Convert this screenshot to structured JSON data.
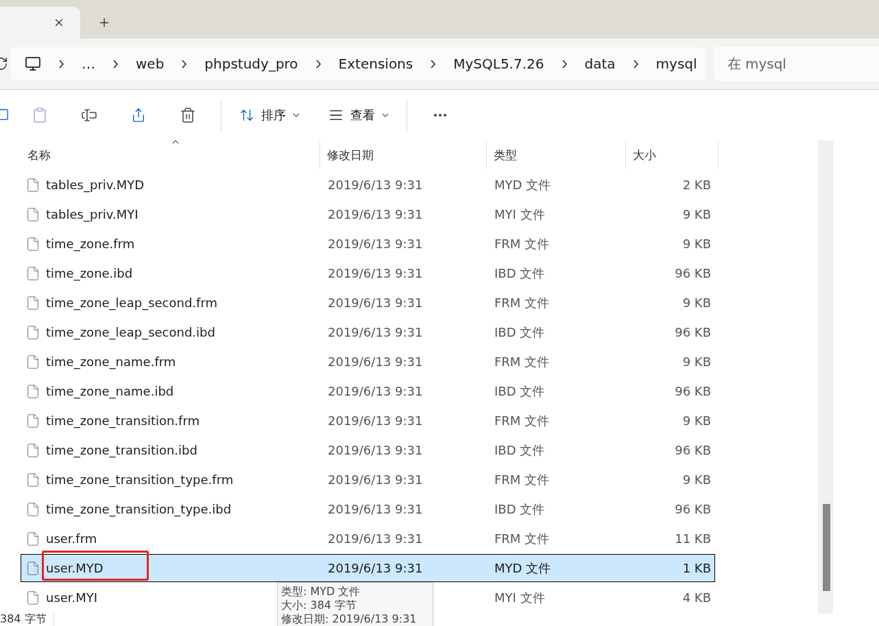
{
  "tabs": [
    {
      "kind": "tab",
      "selected": true
    },
    {
      "kind": "new"
    }
  ],
  "address": {
    "crumbs": [
      "…",
      "web",
      "phpstudy_pro",
      "Extensions",
      "MySQL5.7.26",
      "data",
      "mysql"
    ]
  },
  "search": {
    "placeholder": "在 mysql"
  },
  "toolbar": {
    "sort": "排序",
    "view": "查看"
  },
  "columns": [
    "名称",
    "修改日期",
    "类型",
    "大小"
  ],
  "rows": [
    {
      "name": "tables_priv.MYD",
      "date": "2019/6/13 9:31",
      "type": "MYD 文件",
      "size": "2 KB",
      "selected": false
    },
    {
      "name": "tables_priv.MYI",
      "date": "2019/6/13 9:31",
      "type": "MYI 文件",
      "size": "9 KB",
      "selected": false
    },
    {
      "name": "time_zone.frm",
      "date": "2019/6/13 9:31",
      "type": "FRM 文件",
      "size": "9 KB",
      "selected": false
    },
    {
      "name": "time_zone.ibd",
      "date": "2019/6/13 9:31",
      "type": "IBD 文件",
      "size": "96 KB",
      "selected": false
    },
    {
      "name": "time_zone_leap_second.frm",
      "date": "2019/6/13 9:31",
      "type": "FRM 文件",
      "size": "9 KB",
      "selected": false
    },
    {
      "name": "time_zone_leap_second.ibd",
      "date": "2019/6/13 9:31",
      "type": "IBD 文件",
      "size": "96 KB",
      "selected": false
    },
    {
      "name": "time_zone_name.frm",
      "date": "2019/6/13 9:31",
      "type": "FRM 文件",
      "size": "9 KB",
      "selected": false
    },
    {
      "name": "time_zone_name.ibd",
      "date": "2019/6/13 9:31",
      "type": "IBD 文件",
      "size": "96 KB",
      "selected": false
    },
    {
      "name": "time_zone_transition.frm",
      "date": "2019/6/13 9:31",
      "type": "FRM 文件",
      "size": "9 KB",
      "selected": false
    },
    {
      "name": "time_zone_transition.ibd",
      "date": "2019/6/13 9:31",
      "type": "IBD 文件",
      "size": "96 KB",
      "selected": false
    },
    {
      "name": "time_zone_transition_type.frm",
      "date": "2019/6/13 9:31",
      "type": "FRM 文件",
      "size": "9 KB",
      "selected": false
    },
    {
      "name": "time_zone_transition_type.ibd",
      "date": "2019/6/13 9:31",
      "type": "IBD 文件",
      "size": "96 KB",
      "selected": false
    },
    {
      "name": "user.frm",
      "date": "2019/6/13 9:31",
      "type": "FRM 文件",
      "size": "11 KB",
      "selected": false
    },
    {
      "name": "user.MYD",
      "date": "2019/6/13 9:31",
      "type": "MYD 文件",
      "size": "1 KB",
      "selected": true,
      "highlighted": true
    },
    {
      "name": "user.MYI",
      "type": "MYI 文件",
      "size": "4 KB",
      "selected": false
    }
  ],
  "tooltip": [
    "类型: MYD 文件",
    "大小: 384 字节",
    "修改日期: 2019/6/13 9:31"
  ],
  "status_bar": "384 字节"
}
